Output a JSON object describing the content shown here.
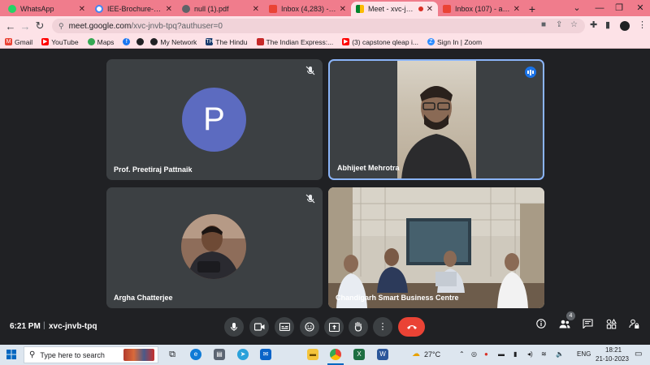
{
  "browser": {
    "tabs": [
      {
        "label": "WhatsApp",
        "icon": "whatsapp-icon",
        "color": "#25d366",
        "active": false
      },
      {
        "label": "IEE-Brochure-12Page",
        "icon": "drive-icon",
        "color": "#ffffff",
        "active": false
      },
      {
        "label": "null (1).pdf",
        "icon": "globe-icon",
        "color": "#5f6368",
        "active": false
      },
      {
        "label": "Inbox (4,283) - quant",
        "icon": "gmail-icon",
        "color": "#ea4335",
        "active": false
      },
      {
        "label": "Meet - xvc-jnvb-",
        "icon": "meet-icon",
        "color": "#00832d",
        "active": true
      },
      {
        "label": "Inbox (107) - acqiasa",
        "icon": "gmail-icon",
        "color": "#ea4335",
        "active": false
      }
    ],
    "url_host": "meet.google.com",
    "url_path": "/xvc-jnvb-tpq?authuser=0",
    "bookmarks": [
      {
        "label": "Gmail",
        "icon": "gmail-icon",
        "color": "#ea4335"
      },
      {
        "label": "YouTube",
        "icon": "youtube-icon",
        "color": "#ff0000"
      },
      {
        "label": "Maps",
        "icon": "maps-icon",
        "color": "#34a853"
      },
      {
        "label": "",
        "icon": "facebook-icon",
        "color": "#1877f2"
      },
      {
        "label": "",
        "icon": "github-icon",
        "color": "#202124"
      },
      {
        "label": "My Network",
        "icon": "github-icon",
        "color": "#202124"
      },
      {
        "label": "The Hindu",
        "icon": "hindu-icon",
        "color": "#1a3c6e"
      },
      {
        "label": "The Indian Express:...",
        "icon": "ie-icon",
        "color": "#c62828"
      },
      {
        "label": "(3) capstone qleap i...",
        "icon": "youtube-icon",
        "color": "#ff0000"
      },
      {
        "label": "Sign In | Zoom",
        "icon": "zoom-icon",
        "color": "#2d8cff"
      }
    ]
  },
  "meet": {
    "participants": [
      {
        "name": "Prof. Preetiraj Pattnaik",
        "initial": "P",
        "muted": true
      },
      {
        "name": "Abhijeet Mehrotra",
        "speaking": true
      },
      {
        "name": "Argha Chatterjee",
        "muted": true
      },
      {
        "name": "Chandigarh Smart Business Centre"
      }
    ],
    "time": "6:21 PM",
    "separator": "|",
    "meeting_code": "xvc-jnvb-tpq",
    "people_count": "4",
    "accent": "#8ab4f8",
    "end_call_color": "#ea4335"
  },
  "taskbar": {
    "search_placeholder": "Type here to search",
    "weather": "27°C",
    "language": "ENG",
    "time": "18:21",
    "date": "21-10-2023"
  }
}
